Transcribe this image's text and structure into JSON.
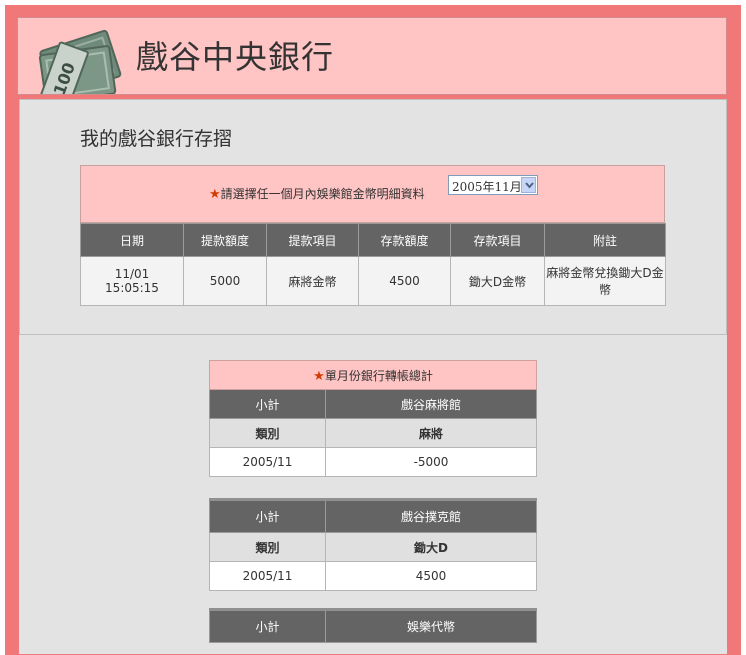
{
  "site": {
    "title": "戲谷中央銀行",
    "logo": "money-bills-logo"
  },
  "page": {
    "heading": "我的戲谷銀行存摺"
  },
  "month_selector": {
    "star": "★",
    "label": "請選擇任一個月內娛樂館金幣明細資料",
    "selected": "2005年11月"
  },
  "detail_table": {
    "headers": [
      "日期",
      "提款額度",
      "提款項目",
      "存款額度",
      "存款項目",
      "附註"
    ],
    "rows": [
      {
        "date": "11/01",
        "time": "15:05:15",
        "withdraw_amount": "5000",
        "withdraw_item": "麻將金幣",
        "deposit_amount": "4500",
        "deposit_item": "鋤大D金幣",
        "note": "麻將金幣兌換鋤大D金幣"
      }
    ]
  },
  "summary": {
    "title": "單月份銀行轉帳總計",
    "blocks": [
      {
        "subtotal_label": "小計",
        "hall": "戲谷麻將館",
        "cat_label": "類別",
        "category": "麻將",
        "month": "2005/11",
        "value": "-5000"
      },
      {
        "subtotal_label": "小計",
        "hall": "戲谷撲克館",
        "cat_label": "類別",
        "category": "鋤大D",
        "month": "2005/11",
        "value": "4500"
      },
      {
        "subtotal_label": "小計",
        "hall": "娛樂代幣"
      }
    ]
  },
  "colors": {
    "frame": "#f07878",
    "header_bg": "#ffc4c4",
    "table_head": "#646464",
    "panel": "#e3e3e3"
  }
}
